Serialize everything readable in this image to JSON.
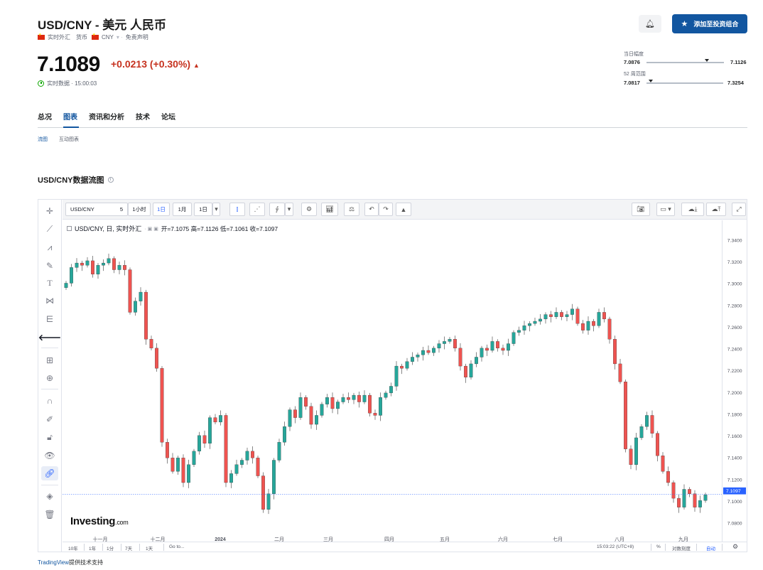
{
  "header": {
    "title": "USD/CNY - 美元 人民币",
    "tags": [
      "实时外汇",
      "货币",
      "CNY",
      "免责声明"
    ],
    "price": "7.1089",
    "change": "+0.0213 (+0.30%)",
    "realtime": "实时数据 · 15:00:03",
    "add_button": "添加至投资组合"
  },
  "ranges": {
    "day_label": "当日幅度",
    "day_low": "7.0876",
    "day_high": "7.1126",
    "day_position": 0.78,
    "week52_label": "52 周范围",
    "week52_low": "7.0817",
    "week52_high": "7.3254",
    "week52_position": 0.06
  },
  "tabs": [
    "总况",
    "图表",
    "资讯和分析",
    "技术",
    "论坛"
  ],
  "active_tab": "图表",
  "subtabs": [
    "流图",
    "互动图表"
  ],
  "section_title": "USD/CNY数据流图",
  "toolbar": {
    "symbol": "USD/CNY",
    "interval_num": "5",
    "intervals": [
      "1小时",
      "1日",
      "1月",
      "1日"
    ],
    "active_interval": "1日"
  },
  "legend": {
    "title": "USD/CNY, 日, 实时外汇",
    "ohlc": "开=7.1075  高=7.1126  低=7.1061  收=7.1097"
  },
  "bottom_bar": {
    "ranges": [
      "10年",
      "1年",
      "1分",
      "7天",
      "1天",
      "Go to..."
    ],
    "time": "15:03:22 (UTC+8)",
    "percent": "%",
    "log": "对数刻度",
    "auto": "自动"
  },
  "logo": {
    "main": "Investing",
    "suffix": ".com"
  },
  "credit": {
    "link": "TradingView",
    "text": "提供技术支持"
  },
  "icons": {
    "up_color": "#26a69a",
    "down_color": "#ef5350",
    "accent": "#1256a0",
    "change_color": "#c6321f"
  },
  "chart_data": {
    "type": "candlestick",
    "symbol": "USD/CNY",
    "interval": "daily",
    "current_price": 7.1097,
    "ylim": [
      7.07,
      7.35
    ],
    "y_ticks": [
      7.34,
      7.32,
      7.3,
      7.28,
      7.26,
      7.24,
      7.22,
      7.2,
      7.18,
      7.16,
      7.14,
      7.12,
      7.1,
      7.08
    ],
    "x_ticks": [
      "十一月",
      "十二月",
      "2024",
      "二月",
      "三月",
      "四月",
      "五月",
      "六月",
      "七月",
      "八月",
      "九月"
    ],
    "close_series": [
      7.298,
      7.312,
      7.316,
      7.314,
      7.318,
      7.306,
      7.314,
      7.316,
      7.32,
      7.31,
      7.314,
      7.31,
      7.272,
      7.282,
      7.29,
      7.248,
      7.24,
      7.222,
      7.156,
      7.142,
      7.13,
      7.142,
      7.12,
      7.136,
      7.148,
      7.162,
      7.155,
      7.178,
      7.174,
      7.18,
      7.12,
      7.128,
      7.136,
      7.14,
      7.148,
      7.142,
      7.126,
      7.096,
      7.11,
      7.14,
      7.156,
      7.17,
      7.185,
      7.178,
      7.196,
      7.188,
      7.172,
      7.18,
      7.19,
      7.196,
      7.186,
      7.192,
      7.196,
      7.194,
      7.198,
      7.192,
      7.198,
      7.182,
      7.18,
      7.196,
      7.2,
      7.206,
      7.224,
      7.222,
      7.228,
      7.232,
      7.234,
      7.238,
      7.236,
      7.24,
      7.244,
      7.246,
      7.248,
      7.24,
      7.224,
      7.214,
      7.226,
      7.232,
      7.24,
      7.238,
      7.246,
      7.24,
      7.238,
      7.244,
      7.254,
      7.256,
      7.26,
      7.262,
      7.264,
      7.266,
      7.27,
      7.268,
      7.272,
      7.268,
      7.27,
      7.275,
      7.262,
      7.256,
      7.264,
      7.26,
      7.272,
      7.266,
      7.248,
      7.226,
      7.21,
      7.15,
      7.136,
      7.16,
      7.17,
      7.18,
      7.164,
      7.144,
      7.13,
      7.12,
      7.106,
      7.098,
      7.114,
      7.11,
      7.098,
      7.104,
      7.109
    ]
  }
}
